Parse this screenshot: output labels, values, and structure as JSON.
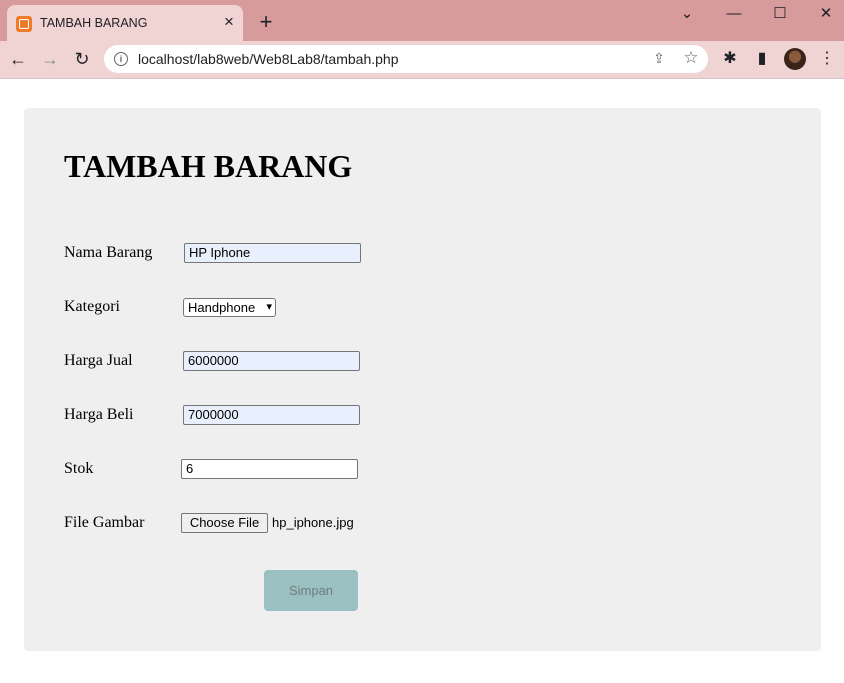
{
  "browser": {
    "tab_title": "TAMBAH BARANG",
    "url": "localhost/lab8web/Web8Lab8/tambah.php"
  },
  "page": {
    "title": "TAMBAH BARANG",
    "fields": {
      "nama_barang": {
        "label": "Nama Barang",
        "value": "HP Iphone"
      },
      "kategori": {
        "label": "Kategori",
        "value": "Handphone"
      },
      "harga_jual": {
        "label": "Harga Jual",
        "value": "6000000"
      },
      "harga_beli": {
        "label": "Harga Beli",
        "value": "7000000"
      },
      "stok": {
        "label": "Stok",
        "value": "6"
      },
      "file_gambar": {
        "label": "File Gambar",
        "button": "Choose File",
        "file_name": "hp_iphone.jpg"
      }
    },
    "submit_label": "Simpan"
  },
  "icons": {
    "tab_close": "×",
    "new_tab": "+",
    "back": "←",
    "forward": "→",
    "reload": "↻",
    "minimize": "—",
    "maximize": "☐",
    "close": "✕",
    "dropdown": "⌄",
    "share": "⇪",
    "star": "☆",
    "extensions": "✱",
    "side_panel": "▮",
    "menu": "⋮",
    "select_arrow": "▾"
  },
  "colors": {
    "tab_bar": "#d89b9c",
    "toolbar": "#f0d4d4",
    "card": "#efefef",
    "autofill": "#e8f0fe",
    "submit": "#9ac0c1"
  }
}
